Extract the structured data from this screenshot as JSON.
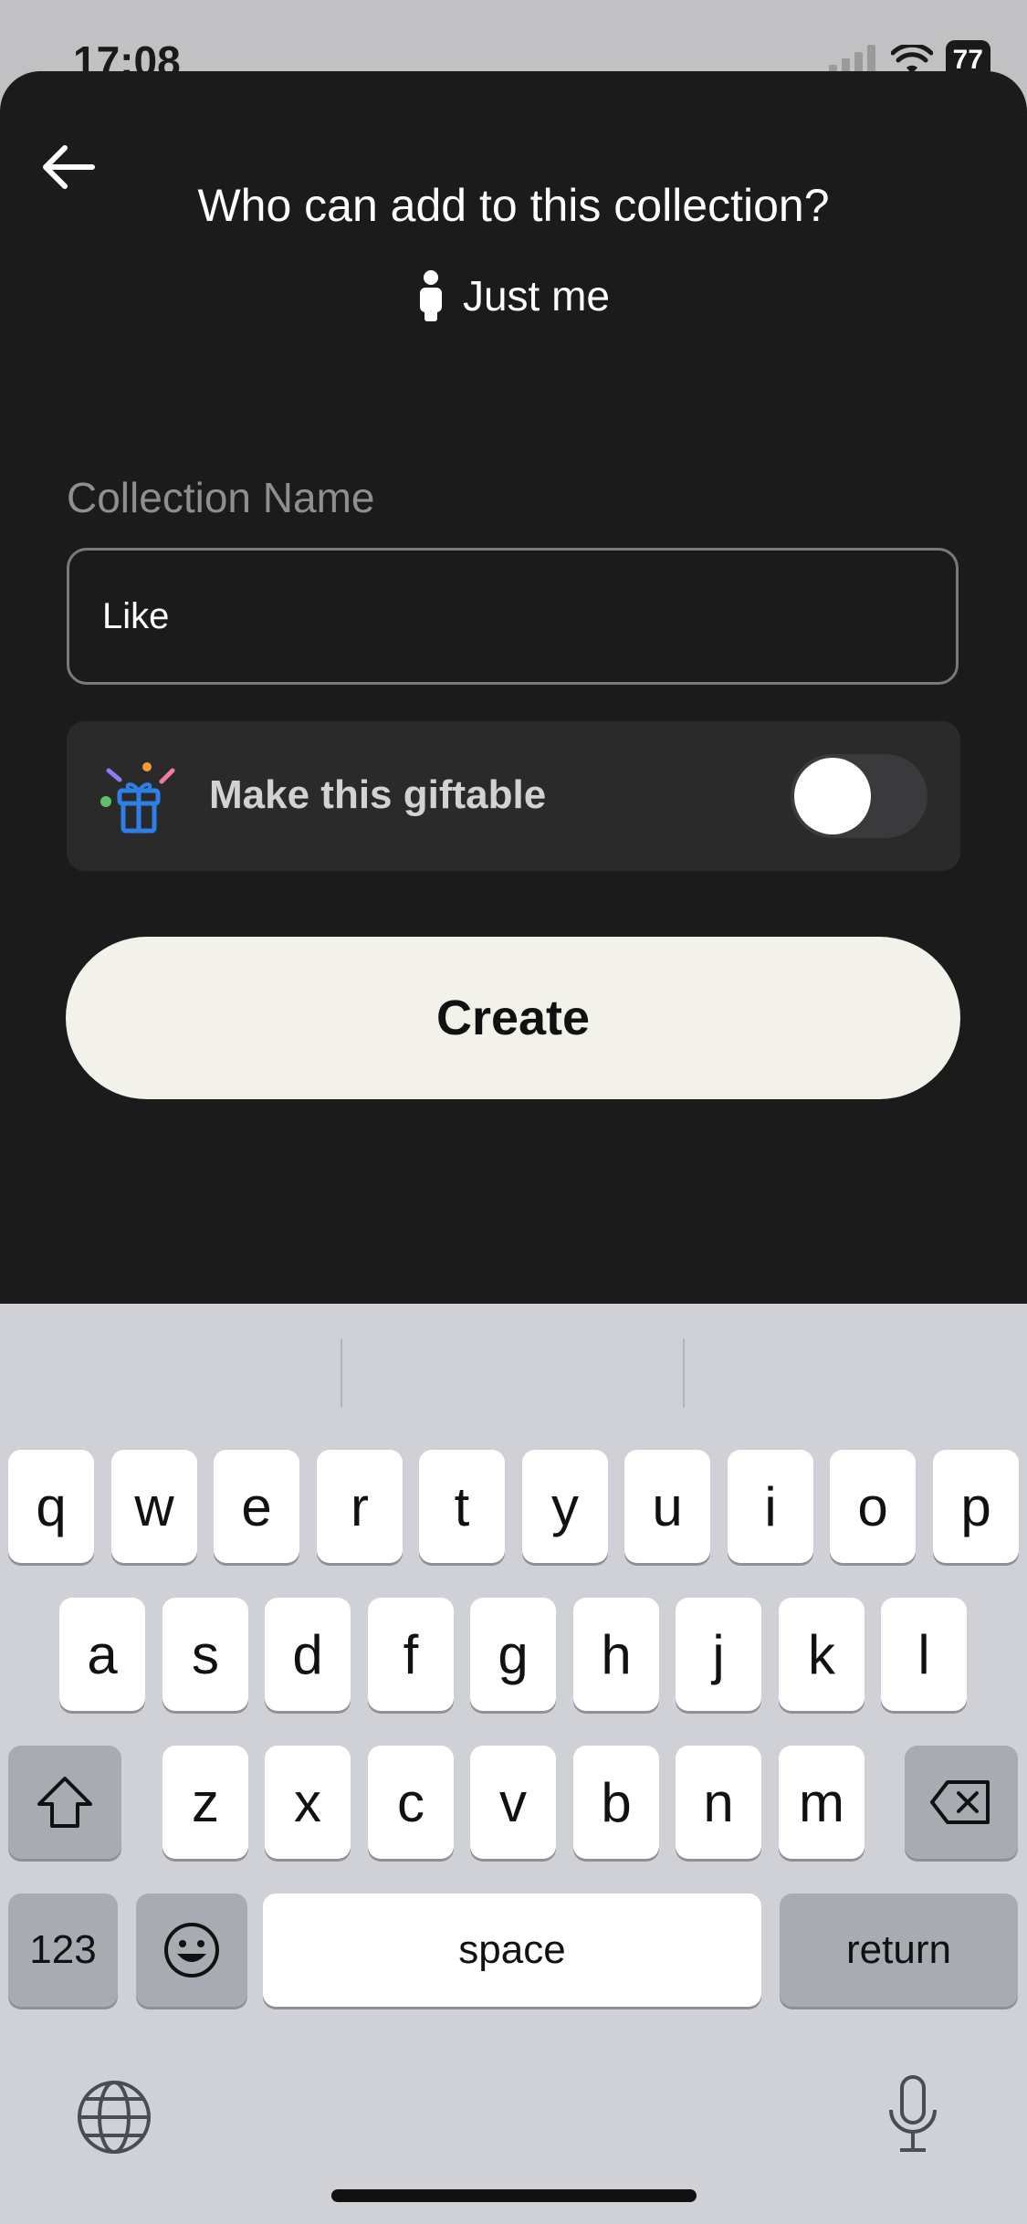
{
  "status": {
    "time": "17:08",
    "battery": "77"
  },
  "sheet": {
    "title": "Who can add to this collection?",
    "access_label": "Just me",
    "field_label": "Collection Name",
    "field_value": "Like",
    "gift_label": "Make this giftable",
    "gift_enabled": false,
    "create_label": "Create"
  },
  "keyboard": {
    "row1": [
      "q",
      "w",
      "e",
      "r",
      "t",
      "y",
      "u",
      "i",
      "o",
      "p"
    ],
    "row2": [
      "a",
      "s",
      "d",
      "f",
      "g",
      "h",
      "j",
      "k",
      "l"
    ],
    "row3": [
      "z",
      "x",
      "c",
      "v",
      "b",
      "n",
      "m"
    ],
    "numbers_label": "123",
    "space_label": "space",
    "return_label": "return"
  }
}
